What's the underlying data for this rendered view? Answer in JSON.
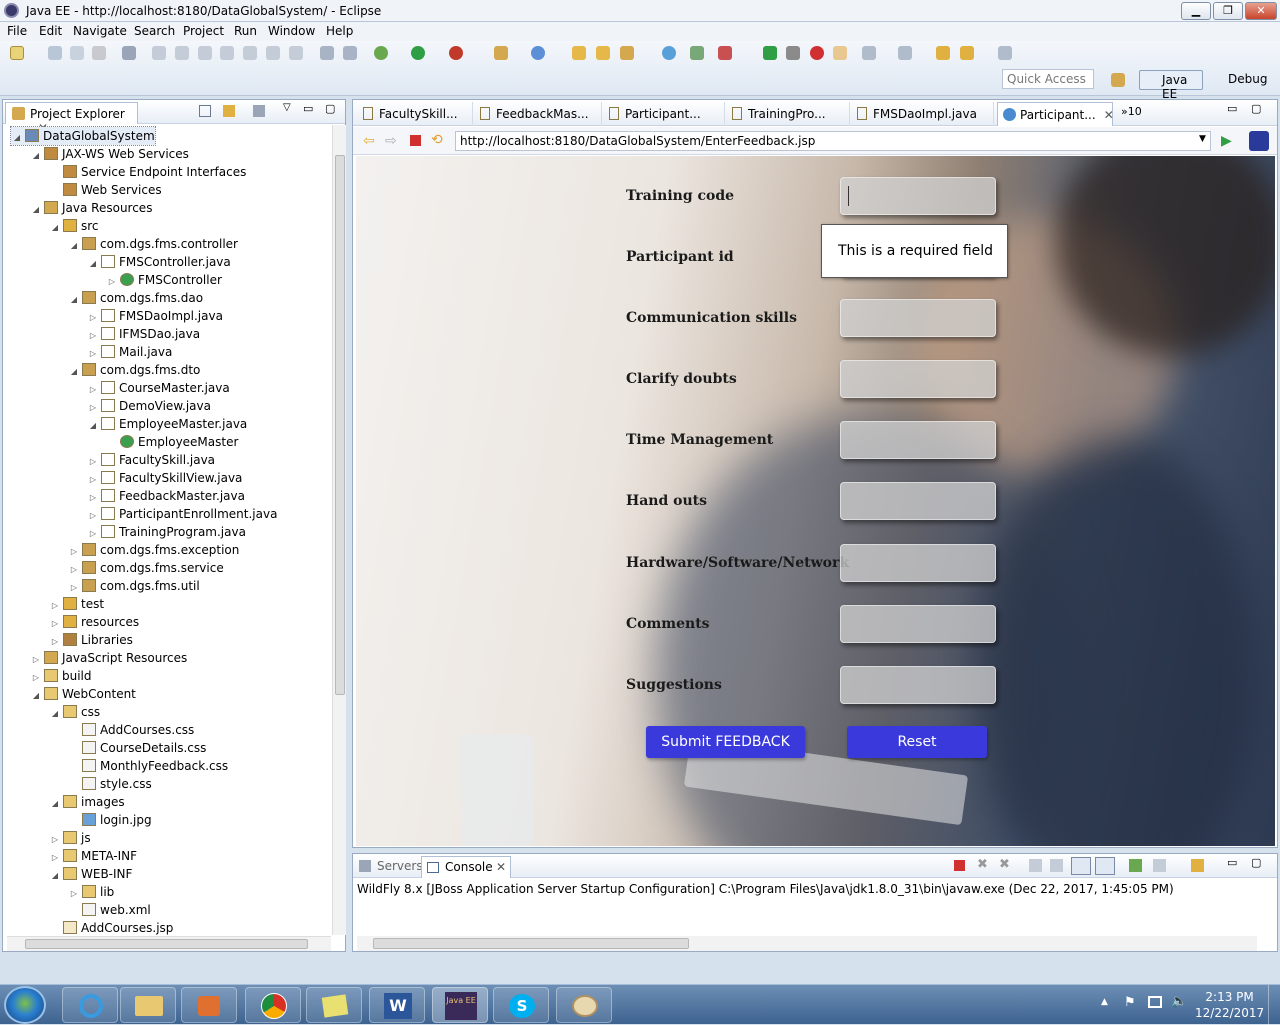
{
  "window": {
    "title": "Java EE - http://localhost:8180/DataGlobalSystem/ - Eclipse",
    "minimize": "▁",
    "restore": "❐",
    "close": "✕"
  },
  "menu": [
    "File",
    "Edit",
    "Navigate",
    "Search",
    "Project",
    "Run",
    "Window",
    "Help"
  ],
  "toolbar": {
    "quick_access_placeholder": "Quick Access",
    "perspective_javaee": "Java EE",
    "perspective_debug": "Debug"
  },
  "explorer": {
    "tab": "Project Explorer",
    "tree": [
      {
        "label": "DataGlobalSystem",
        "twisty": "◢",
        "icon": "project"
      },
      {
        "label": "JAX-WS Web Services",
        "twisty": "◢",
        "icon": "ws"
      },
      {
        "label": "Service Endpoint Interfaces",
        "twisty": "",
        "icon": "ws"
      },
      {
        "label": "Web Services",
        "twisty": "",
        "icon": "ws"
      },
      {
        "label": "Java Resources",
        "twisty": "◢",
        "icon": "jres"
      },
      {
        "label": "src",
        "twisty": "◢",
        "icon": "pkgroot"
      },
      {
        "label": "com.dgs.fms.controller",
        "twisty": "◢",
        "icon": "pkg"
      },
      {
        "label": "FMSController.java",
        "twisty": "◢",
        "icon": "java"
      },
      {
        "label": "FMSController",
        "twisty": "▷",
        "icon": "class"
      },
      {
        "label": "com.dgs.fms.dao",
        "twisty": "◢",
        "icon": "pkg"
      },
      {
        "label": "FMSDaoImpl.java",
        "twisty": "▷",
        "icon": "java"
      },
      {
        "label": "IFMSDao.java",
        "twisty": "▷",
        "icon": "java"
      },
      {
        "label": "Mail.java",
        "twisty": "▷",
        "icon": "java"
      },
      {
        "label": "com.dgs.fms.dto",
        "twisty": "◢",
        "icon": "pkg"
      },
      {
        "label": "CourseMaster.java",
        "twisty": "▷",
        "icon": "java"
      },
      {
        "label": "DemoView.java",
        "twisty": "▷",
        "icon": "java"
      },
      {
        "label": "EmployeeMaster.java",
        "twisty": "◢",
        "icon": "java"
      },
      {
        "label": "EmployeeMaster",
        "twisty": "",
        "icon": "class"
      },
      {
        "label": "FacultySkill.java",
        "twisty": "▷",
        "icon": "java"
      },
      {
        "label": "FacultySkillView.java",
        "twisty": "▷",
        "icon": "java"
      },
      {
        "label": "FeedbackMaster.java",
        "twisty": "▷",
        "icon": "java"
      },
      {
        "label": "ParticipantEnrollment.java",
        "twisty": "▷",
        "icon": "java"
      },
      {
        "label": "TrainingProgram.java",
        "twisty": "▷",
        "icon": "java"
      },
      {
        "label": "com.dgs.fms.exception",
        "twisty": "▷",
        "icon": "pkg"
      },
      {
        "label": "com.dgs.fms.service",
        "twisty": "▷",
        "icon": "pkg"
      },
      {
        "label": "com.dgs.fms.util",
        "twisty": "▷",
        "icon": "pkg"
      },
      {
        "label": "test",
        "twisty": "▷",
        "icon": "pkgroot"
      },
      {
        "label": "resources",
        "twisty": "▷",
        "icon": "pkgroot"
      },
      {
        "label": "Libraries",
        "twisty": "▷",
        "icon": "lib"
      },
      {
        "label": "JavaScript Resources",
        "twisty": "▷",
        "icon": "jsres"
      },
      {
        "label": "build",
        "twisty": "▷",
        "icon": "folder"
      },
      {
        "label": "WebContent",
        "twisty": "◢",
        "icon": "folder"
      },
      {
        "label": "css",
        "twisty": "◢",
        "icon": "folder"
      },
      {
        "label": "AddCourses.css",
        "twisty": "",
        "icon": "file"
      },
      {
        "label": "CourseDetails.css",
        "twisty": "",
        "icon": "file"
      },
      {
        "label": "MonthlyFeedback.css",
        "twisty": "",
        "icon": "file"
      },
      {
        "label": "style.css",
        "twisty": "",
        "icon": "file"
      },
      {
        "label": "images",
        "twisty": "◢",
        "icon": "folder"
      },
      {
        "label": "login.jpg",
        "twisty": "",
        "icon": "image"
      },
      {
        "label": "js",
        "twisty": "▷",
        "icon": "folder"
      },
      {
        "label": "META-INF",
        "twisty": "▷",
        "icon": "folder"
      },
      {
        "label": "WEB-INF",
        "twisty": "◢",
        "icon": "folder"
      },
      {
        "label": "lib",
        "twisty": "▷",
        "icon": "folder"
      },
      {
        "label": "web.xml",
        "twisty": "",
        "icon": "xml"
      },
      {
        "label": "AddCourses.jsp",
        "twisty": "",
        "icon": "jsp"
      }
    ]
  },
  "editor": {
    "tabs": [
      "FacultySkill...",
      "FeedbackMas...",
      "Participant...",
      "TrainingPro...",
      "FMSDaoImpl.java",
      "Participant..."
    ],
    "overflow": "»10",
    "url": "http://localhost:8180/DataGlobalSystem/EnterFeedback.jsp"
  },
  "form": {
    "fields": [
      "Training code",
      "Participant id",
      "Communication skills",
      "Clarify doubts",
      "Time Management",
      "Hand outs",
      "Hardware/Software/Network",
      "Comments",
      "Suggestions"
    ],
    "tooltip": "This is a required field",
    "submit": "Submit FEEDBACK",
    "reset": "Reset"
  },
  "console": {
    "tabs": [
      "Servers",
      "Console"
    ],
    "text": "WildFly 8.x [JBoss Application Server Startup Configuration] C:\\Program Files\\Java\\jdk1.8.0_31\\bin\\javaw.exe (Dec 22, 2017, 1:45:05 PM)"
  },
  "taskbar": {
    "time": "2:13 PM",
    "date": "12/22/2017",
    "eclipse_label": "Java EE"
  },
  "colors": {
    "accent_button": "#3a3adc",
    "window_bg": "#d6e1ee"
  }
}
